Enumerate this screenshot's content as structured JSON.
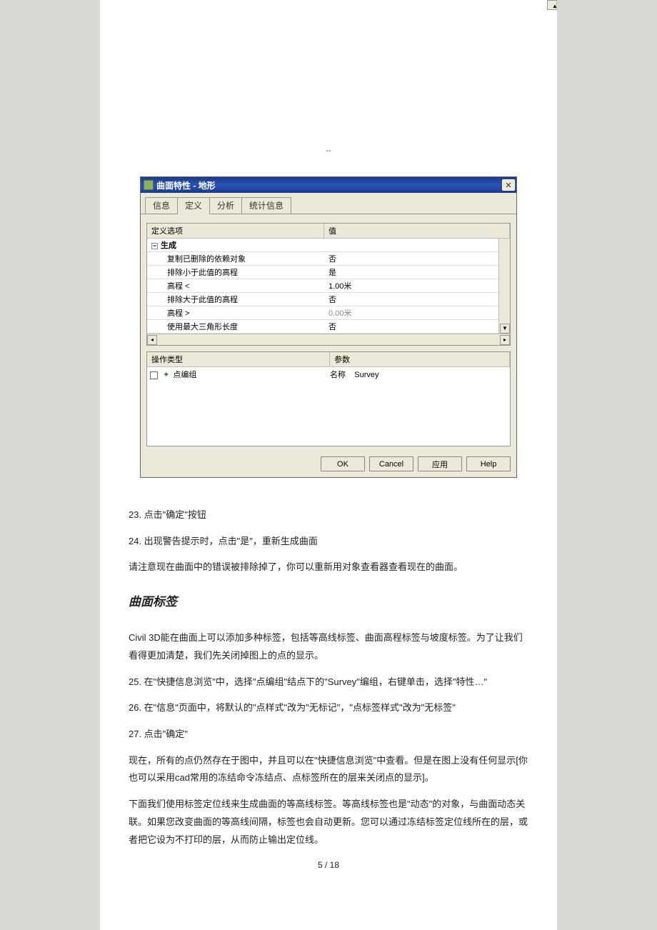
{
  "dialog": {
    "title": "曲面特性 - 地形",
    "close_glyph": "✕",
    "tabs": [
      "信息",
      "定义",
      "分析",
      "统计信息"
    ],
    "active_tab": 1,
    "grid1": {
      "headers": [
        "定义选项",
        "值"
      ],
      "group": "生成",
      "rows": [
        {
          "label": "复制已删除的依赖对象",
          "value": "否"
        },
        {
          "label": "排除小于此值的高程",
          "value": "是"
        },
        {
          "label": "高程 <",
          "value": "1.00米"
        },
        {
          "label": "排除大于此值的高程",
          "value": "否"
        },
        {
          "label": "高程 >",
          "value": "0.00米"
        },
        {
          "label": "使用最大三角形长度",
          "value": "否"
        }
      ]
    },
    "grid2": {
      "headers": [
        "操作类型",
        "参数"
      ],
      "row": {
        "label": "点编组",
        "param_label": "名称",
        "param_value": "Survey"
      }
    },
    "buttons": {
      "ok": "OK",
      "cancel": "Cancel",
      "apply": "应用",
      "help": "Help"
    }
  },
  "body": {
    "p23": "23. 点击\"确定\"按钮",
    "p24": "24. 出现警告提示时，点击\"是\"，重新生成曲面",
    "note1": "请注意现在曲面中的错误被排除掉了，你可以重新用对象查看器查看现在的曲面。",
    "section_title": "曲面标签",
    "intro": "Civil 3D能在曲面上可以添加多种标签，包括等高线标签、曲面高程标签与坡度标签。为了让我们看得更加清楚，我们先关闭掉图上的点的显示。",
    "p25": "25. 在\"快捷信息浏览\"中，选择\"点编组\"结点下的\"Survey\"编组，右键单击，选择\"特性…\"",
    "p26": "26. 在\"信息\"页面中，将默认的\"点样式\"改为\"无标记\"，\"点标签样式\"改为\"无标签\"",
    "p27": "27. 点击\"确定\"",
    "para1": "现在，所有的点仍然存在于图中，并且可以在\"快捷信息浏览\"中查看。但是在图上没有任何显示[你也可以采用cad常用的冻结命令冻结点、点标签所在的层来关闭点的显示]。",
    "para2": "下面我们使用标签定位线来生成曲面的等高线标签。等高线标签也是\"动态\"的对象，与曲面动态关联。如果您改变曲面的等高线间隔，标签也会自动更新。您可以通过冻结标签定位线所在的层，或者把它设为不打印的层，从而防止输出定位线。",
    "page_num": "5 / 18"
  }
}
